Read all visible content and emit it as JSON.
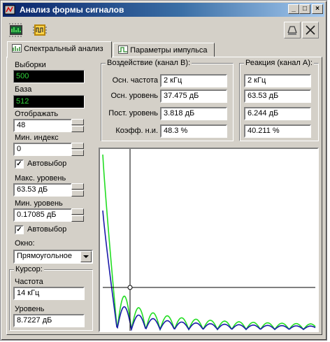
{
  "window": {
    "title": "Анализ формы сигналов"
  },
  "titlebar_buttons": {
    "minimize": "_",
    "maximize": "□",
    "close": "×"
  },
  "toolbar": {
    "left_icons": [
      "spectrum-chip-icon",
      "pulse-chip-icon"
    ],
    "right_icons": [
      "print-icon",
      "close-panel-icon"
    ]
  },
  "tabs": [
    {
      "label": "Спектральный анализ",
      "active": true
    },
    {
      "label": "Параметры импульса",
      "active": false
    }
  ],
  "left_panel": {
    "samples_label": "Выборки",
    "samples_value": "500",
    "base_label": "База",
    "base_value": "512",
    "display_label": "Отображать",
    "display_value": "48",
    "min_index_label": "Мин. индекс",
    "min_index_value": "0",
    "autoselect1_label": "Автовыбор",
    "autoselect1_checked": true,
    "max_level_label": "Макс. уровень",
    "max_level_value": "63.53 дБ",
    "min_level_label": "Мин. уровень",
    "min_level_value": "0.17085 дБ",
    "autoselect2_label": "Автовыбор",
    "autoselect2_checked": true,
    "window_label": "Окно:",
    "window_value": "Прямоугольное"
  },
  "cursor": {
    "group_title": "Курсор:",
    "freq_label": "Частота",
    "freq_value": "14 кГц",
    "level_label": "Уровень",
    "level_value": "8.7227 дБ"
  },
  "stimulus": {
    "group_title": "Воздействие (канал B):",
    "rows": [
      {
        "label": "Осн. частота",
        "value": "2 кГц"
      },
      {
        "label": "Осн. уровень",
        "value": "37.475 дБ"
      },
      {
        "label": "Пост. уровень",
        "value": "3.818 дБ"
      },
      {
        "label": "Коэфф. н.и.",
        "value": "48.3 %"
      }
    ]
  },
  "response": {
    "group_title": "Реакция (канал A):",
    "values": [
      "2 кГц",
      "63.53 дБ",
      "6.244 дБ",
      "40.211 %"
    ]
  },
  "colors": {
    "lcd_text": "#2fd33a",
    "series_green": "#22dd22",
    "series_blue": "#1a1aa8",
    "series_red": "#cc2222",
    "cursor_line": "#000000"
  }
}
